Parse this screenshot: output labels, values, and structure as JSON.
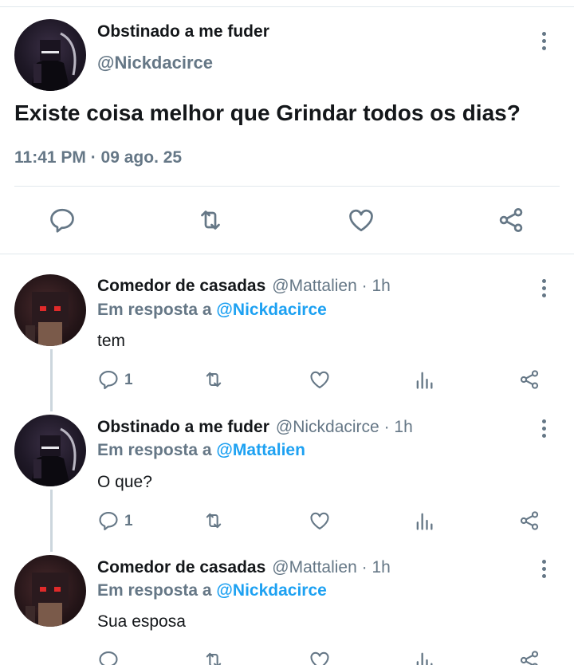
{
  "tweet": {
    "author_name": "Obstinado a me fuder",
    "author_handle": "@Nickdacirce",
    "text": "Existe coisa melhor que Grindar todos os dias?",
    "timestamp": "11:41 PM · 09 ago. 25"
  },
  "replies": [
    {
      "author_name": "Comedor de casadas",
      "author_handle": "@Mattalien",
      "time": "· 1h",
      "in_reply_label": "Em resposta a",
      "in_reply_to": "@Nickdacirce",
      "text": "tem",
      "reply_count": "1"
    },
    {
      "author_name": "Obstinado a me fuder",
      "author_handle": "@Nickdacirce",
      "time": "· 1h",
      "in_reply_label": "Em resposta a",
      "in_reply_to": "@Mattalien",
      "text": "O que?",
      "reply_count": "1"
    },
    {
      "author_name": "Comedor de casadas",
      "author_handle": "@Mattalien",
      "time": "· 1h",
      "in_reply_label": "Em resposta a",
      "in_reply_to": "@Nickdacirce",
      "text": "Sua esposa",
      "reply_count": ""
    }
  ],
  "icons": {
    "reply": "speech-bubble-icon",
    "retweet": "retweet-icon",
    "like": "heart-icon",
    "analytics": "bar-chart-icon",
    "share": "share-icon",
    "more": "vertical-ellipsis-icon"
  },
  "colors": {
    "link": "#1da1f2",
    "secondary_text": "#657786",
    "icon": "#657786",
    "divider": "#e1e8ed"
  }
}
